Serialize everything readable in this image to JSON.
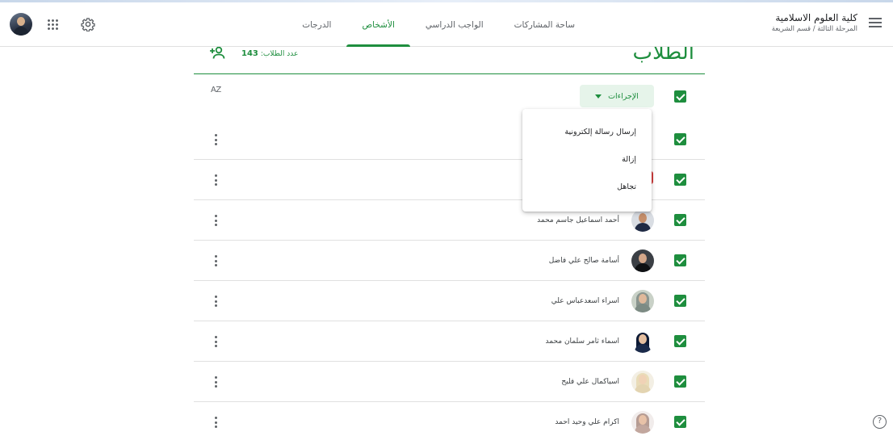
{
  "header": {
    "class_name": "كلية العلوم الاسلامية",
    "class_subtitle": "المرحلة الثالثة / قسم الشريعة",
    "tabs": [
      {
        "label": "ساحة المشاركات"
      },
      {
        "label": "الواجب الدراسي"
      },
      {
        "label": "الأشخاص"
      },
      {
        "label": "الدرجات"
      }
    ],
    "active_tab": "الأشخاص",
    "icons": [
      "menu-icon",
      "settings-gear-icon",
      "google-apps-icon",
      "account-avatar"
    ]
  },
  "students_section": {
    "heading": "الطلاب",
    "count_label": "عدد الطلاب:",
    "count_value": "143",
    "actions_label": "الإجراءات",
    "sort_icon": "AZ"
  },
  "actions_menu": {
    "items": [
      {
        "label": "إرسال رسالة إلكترونية"
      },
      {
        "label": "إزالة"
      },
      {
        "label": "تجاهل"
      }
    ]
  },
  "students": [
    {
      "name": "أحمد اسماعيل جاسم محمد",
      "checked": true,
      "avatar": "male"
    },
    {
      "name": "أسامة صالح علي فاضل",
      "checked": true,
      "avatar": "male"
    },
    {
      "name": "اسراء اسعدعباس علي",
      "checked": true,
      "avatar": "female"
    },
    {
      "name": "اسماء ثامر سلمان محمد",
      "checked": true,
      "avatar": "female"
    },
    {
      "name": "اسياكمال علي فليح",
      "checked": true,
      "avatar": "female"
    },
    {
      "name": "اكرام علي وحيد احمد",
      "checked": true,
      "avatar": "female"
    }
  ],
  "colors": {
    "accent": "#1e8e3e",
    "accent_light": "#e6f4ea",
    "text": "#3c4043",
    "divider": "#e0e0e0"
  },
  "help_icon": "?"
}
